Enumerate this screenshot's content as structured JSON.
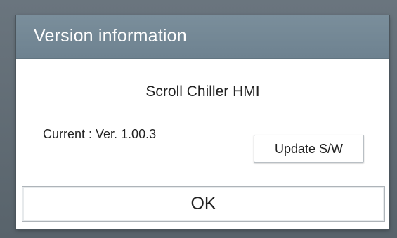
{
  "dialog": {
    "title": "Version information",
    "app_name": "Scroll Chiller HMI",
    "current_version": "Current : Ver. 1.00.3",
    "update_button_label": "Update S/W",
    "ok_button_label": "OK"
  },
  "colors": {
    "title_bar": "#7489966",
    "background_overlay": "#5f6a72",
    "dialog_body": "#ffffff",
    "text": "#222222"
  }
}
